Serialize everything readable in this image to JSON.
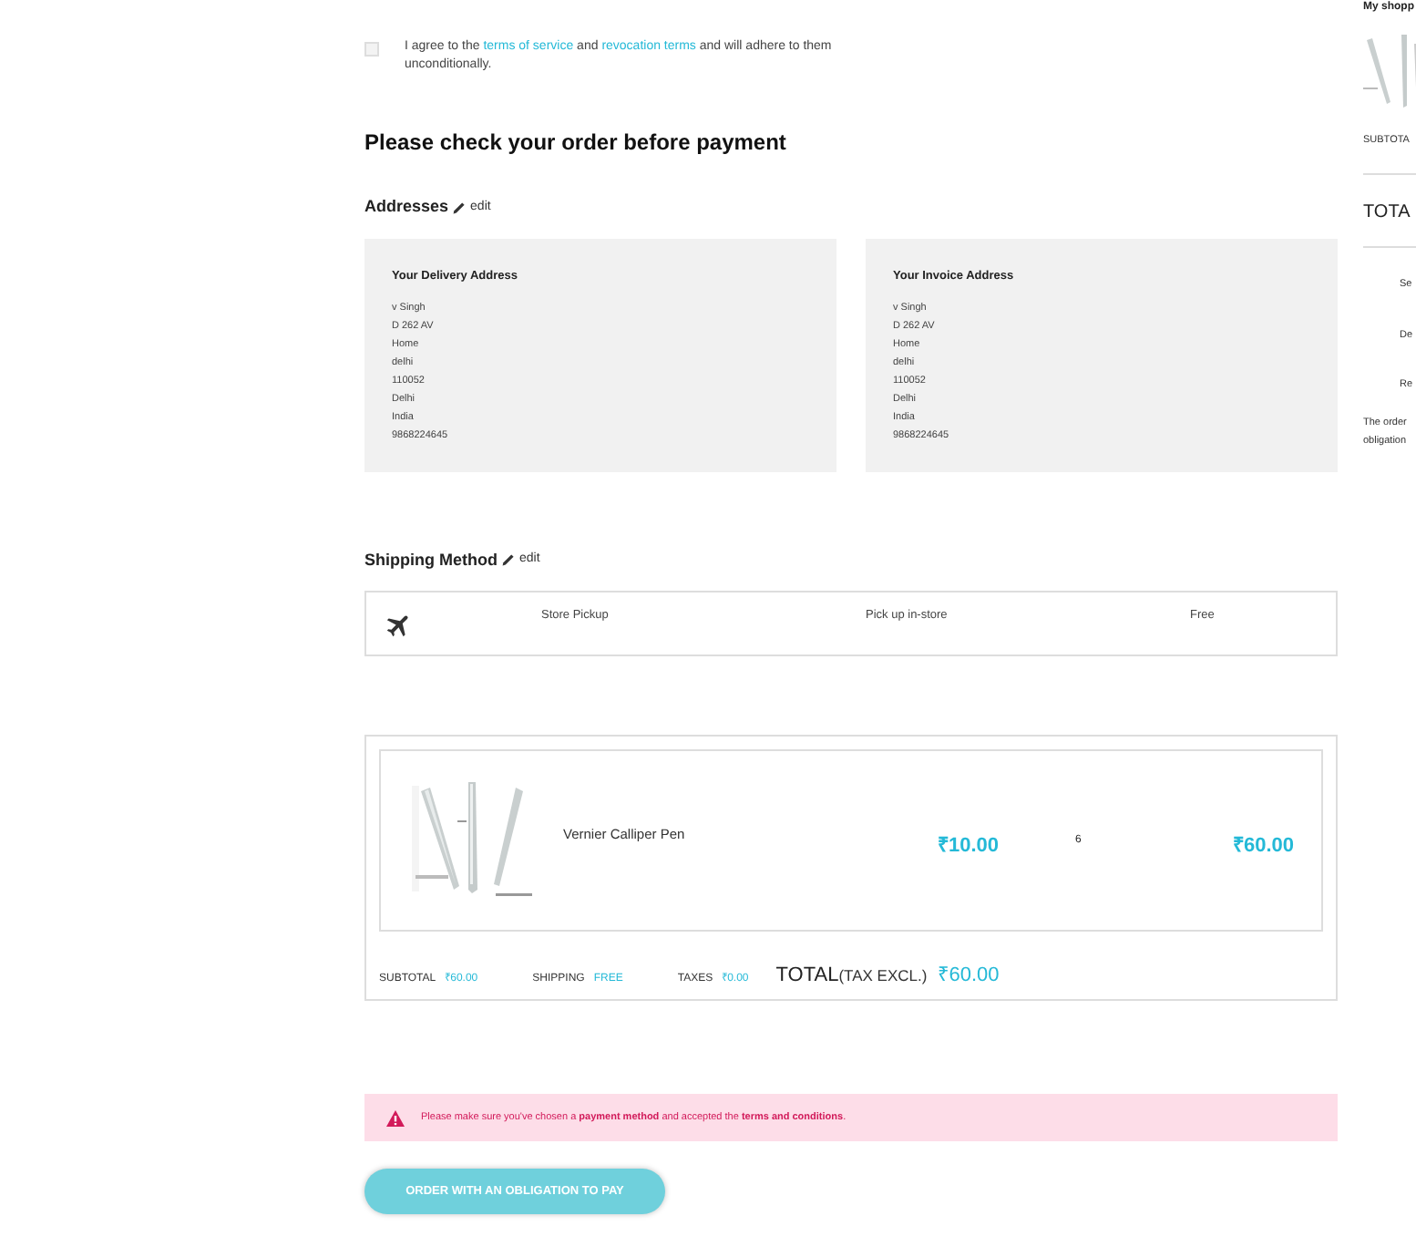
{
  "agreement": {
    "checked": false,
    "parts": [
      {
        "kind": "text",
        "text": "I agree to the "
      },
      {
        "kind": "link",
        "text": "terms of service"
      },
      {
        "kind": "text",
        "text": " and "
      },
      {
        "kind": "link",
        "text": "revocation terms"
      },
      {
        "kind": "text",
        "text": " and will adhere to them unconditionally."
      }
    ]
  },
  "heading": "Please check your order before payment",
  "addresses": {
    "title": "Addresses",
    "edit": "edit",
    "cards": [
      {
        "title": "Your Delivery Address",
        "lines": [
          "v Singh",
          "D 262 AV",
          "Home",
          "delhi",
          "110052",
          "Delhi",
          "India",
          "9868224645"
        ]
      },
      {
        "title": "Your Invoice Address",
        "lines": [
          "v Singh",
          "D 262 AV",
          "Home",
          "delhi",
          "110052",
          "Delhi",
          "India",
          "9868224645"
        ]
      }
    ]
  },
  "shipping": {
    "title": "Shipping Method",
    "edit": "edit",
    "carrier": "Store Pickup",
    "delay": "Pick up in-store",
    "price": "Free"
  },
  "product": {
    "name": "Vernier Calliper Pen",
    "unit_price": "₹10.00",
    "quantity": "6",
    "total": "₹60.00"
  },
  "totals": {
    "subtotal_label": "SUBTOTAL",
    "subtotal": "₹60.00",
    "shipping_label": "SHIPPING",
    "shipping": "FREE",
    "taxes_label": "TAXES",
    "taxes": "₹0.00",
    "total_label": "TOTAL",
    "total_note": "(TAX EXCL.)",
    "total": "₹60.00"
  },
  "alert": "Please make sure you've chosen a **payment method** and accepted the **terms and conditions**.",
  "order_button": "ORDER WITH AN OBLIGATION TO PAY",
  "sidebar": {
    "title": "My shopp",
    "subtotal": "SUBTOTA",
    "total": "TOTA",
    "items": [
      "Se",
      "De",
      "Re"
    ],
    "note_lines": [
      "The order",
      "obligation"
    ]
  }
}
